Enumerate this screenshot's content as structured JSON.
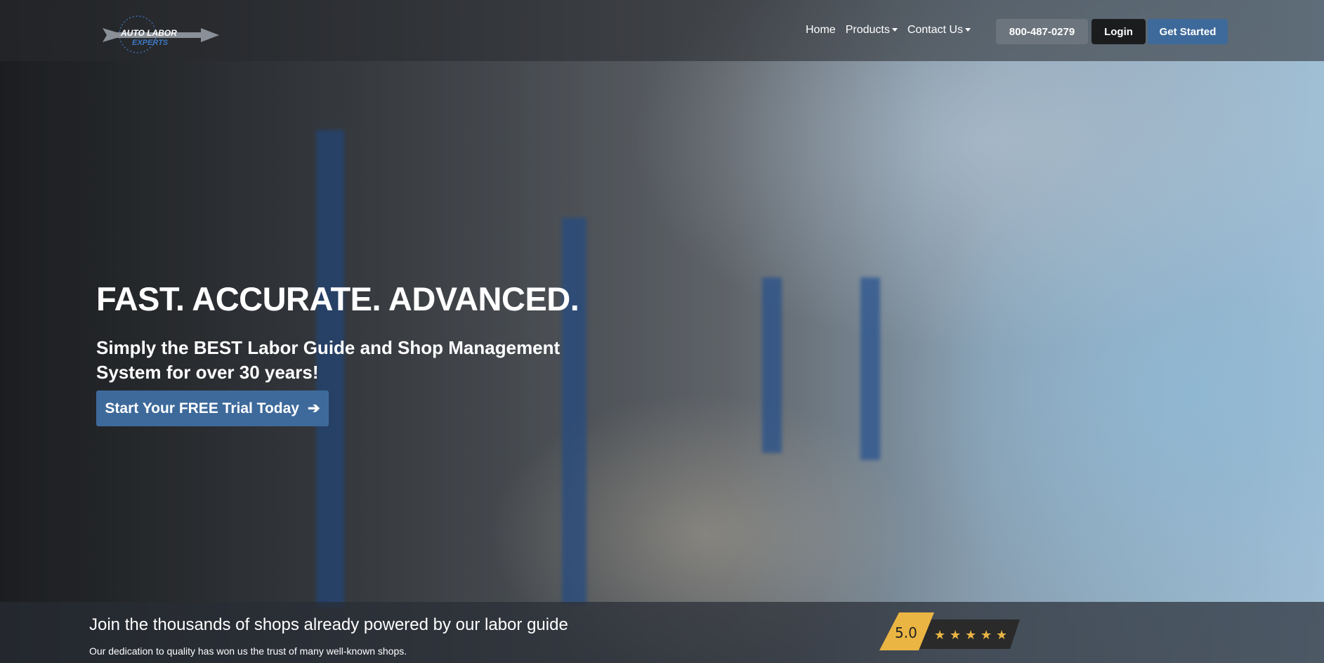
{
  "nav": {
    "logo_text": "AUTO LABOR EXPERTS",
    "links": [
      "Home",
      "Products",
      "Contact Us"
    ],
    "phone": "800-487-0279",
    "login": "Login",
    "get_started": "Get Started"
  },
  "hero": {
    "headline": "FAST. ACCURATE. ADVANCED.",
    "subtitle": "Simply the BEST Labor Guide and Shop Management System for over 30 years!",
    "cta": "Start Your FREE Trial Today"
  },
  "band": {
    "title": "Join the thousands of shops already powered by our labor guide",
    "text": "Our dedication to quality has won us the trust of many well-known shops.",
    "rating": "5.0",
    "stars": 5
  },
  "colors": {
    "primary": "#3e6a9b",
    "rating_yellow": "#eab543"
  }
}
